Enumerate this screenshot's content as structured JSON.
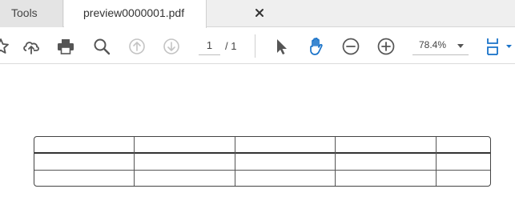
{
  "tabs": {
    "tools_label": "Tools",
    "document_label": "preview0000001.pdf",
    "close_icon": "close-icon"
  },
  "toolbar": {
    "icons": [
      "star-icon",
      "cloud-upload-icon",
      "print-icon",
      "search-icon",
      "page-up-icon",
      "page-down-icon",
      "select-arrow-icon",
      "hand-tool-icon",
      "zoom-out-icon",
      "zoom-in-icon",
      "page-layout-icon"
    ],
    "page_current": "1",
    "page_total": "/ 1",
    "zoom": "78.4%",
    "accent_color": "#1a73c9"
  },
  "document": {
    "table": {
      "columns": 5,
      "rows": 3,
      "cells": [
        [
          "",
          "",
          "",
          "",
          ""
        ],
        [
          "",
          "",
          "",
          "",
          ""
        ],
        [
          "",
          "",
          "",
          "",
          ""
        ]
      ]
    }
  }
}
